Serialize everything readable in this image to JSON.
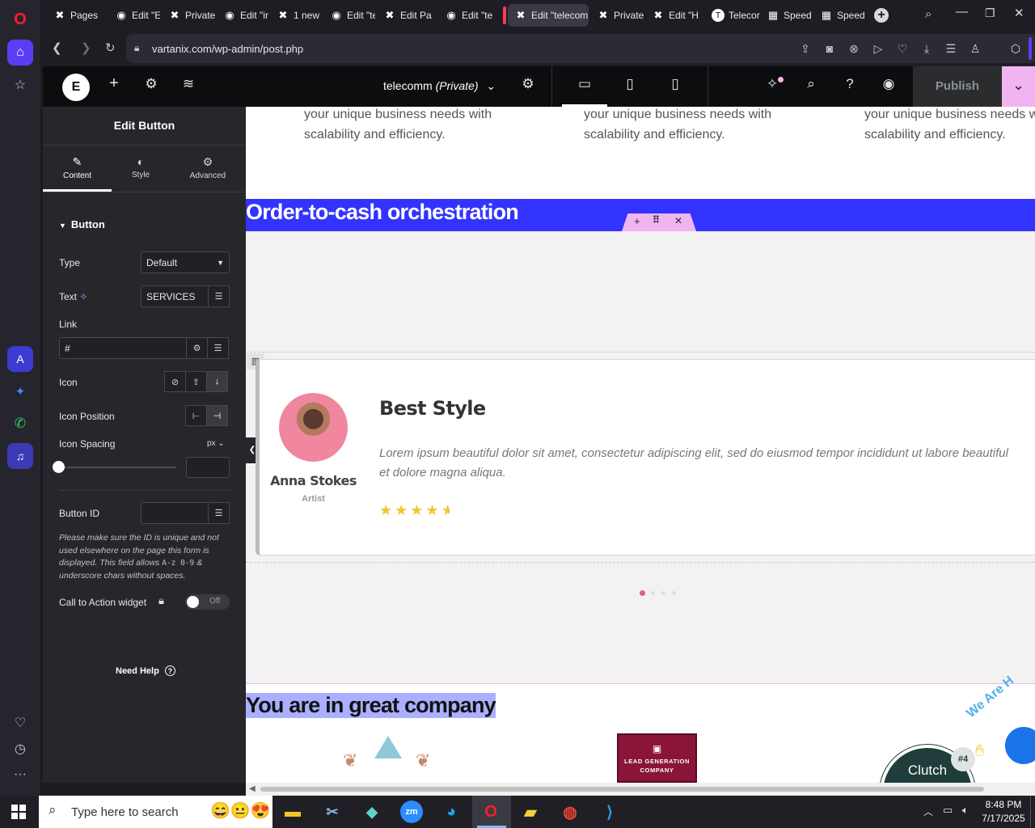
{
  "tabs": [
    {
      "label": "Pages",
      "icon": "wordpress-x-icon"
    },
    {
      "label": "Edit \"El",
      "icon": "globe-icon"
    },
    {
      "label": "Private",
      "icon": "wordpress-x-icon"
    },
    {
      "label": "Edit \"in",
      "icon": "globe-icon"
    },
    {
      "label": "1 new",
      "icon": "wordpress-x-icon"
    },
    {
      "label": "Edit \"te",
      "icon": "globe-icon"
    },
    {
      "label": "Edit Pa",
      "icon": "wordpress-x-icon"
    },
    {
      "label": "Edit \"te",
      "icon": "globe-icon"
    },
    {
      "label": "Edit \"telecom",
      "icon": "wordpress-x-icon"
    },
    {
      "label": "Private",
      "icon": "wordpress-x-icon"
    },
    {
      "label": "Edit \"H",
      "icon": "wordpress-x-icon"
    },
    {
      "label": "Telecor",
      "icon": "telecom-icon"
    },
    {
      "label": "Speed",
      "icon": "grid-icon"
    },
    {
      "label": "Speed",
      "icon": "grid-icon"
    }
  ],
  "address": {
    "url": "vartanix.com/wp-admin/post.php"
  },
  "editor": {
    "page_name": "telecomm",
    "page_status": "(Private)",
    "publish_label": "Publish"
  },
  "panel": {
    "title": "Edit Button",
    "tabs": {
      "content": "Content",
      "style": "Style",
      "advanced": "Advanced"
    },
    "section": "Button",
    "type_label": "Type",
    "type_value": "Default",
    "text_label": "Text",
    "text_value": "SERVICES",
    "link_label": "Link",
    "link_value": "#",
    "icon_label": "Icon",
    "icon_position_label": "Icon Position",
    "icon_spacing_label": "Icon Spacing",
    "icon_spacing_unit": "px",
    "button_id_label": "Button ID",
    "button_id_note": "Please make sure the ID is unique and not used elsewhere on the page this form is displayed. This field allows",
    "button_id_code": "A-z 0-9",
    "button_id_note2": "& underscore chars without spaces.",
    "cta_label": "Call to Action widget",
    "cta_toggle": "Off",
    "need_help": "Need Help"
  },
  "canvas": {
    "top_text_1": "your unique business needs with",
    "top_text_2": "scalability and efficiency.",
    "top_text_1b": "your unique business needs with",
    "top_text_2b": "scalability and efficiency.",
    "top_text_1c": "your unique business needs w",
    "top_text_2c": "scalability and efficiency.",
    "banner_heading": "Order-to-cash orchestration",
    "testimonial": {
      "name": "Anna Stokes",
      "role": "Artist",
      "title": "Best Style",
      "quote": "Lorem ipsum beautiful dolor sit amet, consectetur adipiscing elit, sed do eiusmod tempor incididunt ut labore beautiful et dolore magna aliqua.",
      "rating": 4.5,
      "max_rating": 5
    },
    "company_heading": "You are in great company",
    "lead_gen_1": "LEAD GENERATION",
    "lead_gen_2": "COMPANY",
    "clutch_label": "Clutch",
    "clutch_badge": "#4",
    "sticker_text": "We Are H"
  },
  "taskbar": {
    "search_placeholder": "Type here to search",
    "time": "8:48 PM",
    "date": "7/17/2025"
  },
  "colors": {
    "banner": "#3333ff",
    "elementor_pink": "#f0b4f0",
    "star": "#f4c430",
    "dot_active": "#e6579a"
  }
}
